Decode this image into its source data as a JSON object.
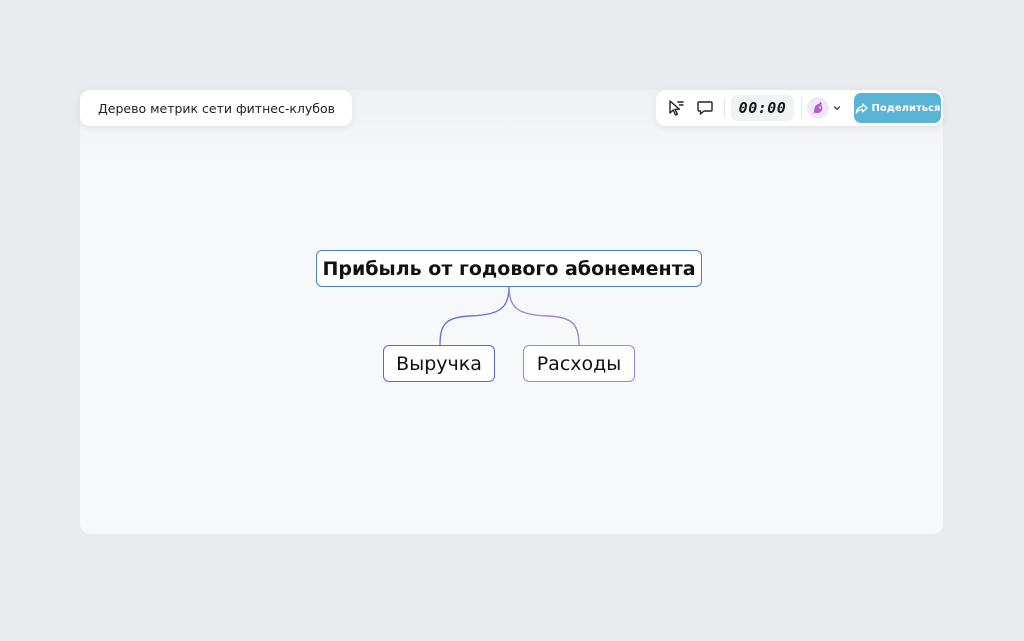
{
  "document": {
    "title": "Дерево метрик сети фитнес-клубов"
  },
  "toolbar": {
    "icons": [
      "cursor-select-icon",
      "comment-icon",
      "chevron-down-icon",
      "share-arrow-icon"
    ],
    "timer": "00:00",
    "share_label": "Поделиться"
  },
  "mindmap": {
    "root": "Прибыль от годового абонемента",
    "children": [
      "Выручка",
      "Расходы"
    ]
  },
  "colors": {
    "background": "#e9eaed",
    "board": "#f7f8fa",
    "share_button": "#5ab4d6",
    "root_border": "#4d7fc4",
    "child_1_border": "#5a6ad0",
    "child_2_border": "#9b86d8"
  }
}
